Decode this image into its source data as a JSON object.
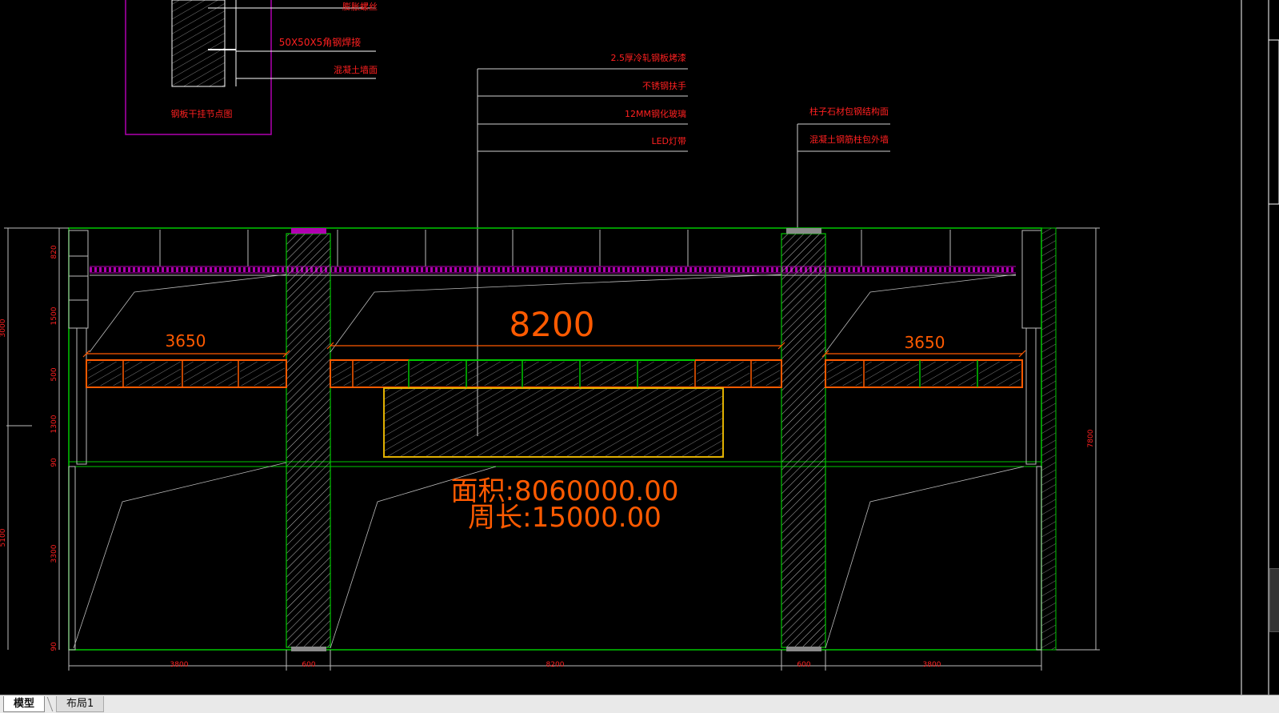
{
  "tabs": [
    {
      "label": "模型",
      "active": true
    },
    {
      "label": "布局1",
      "active": false
    }
  ],
  "detail_box": {
    "title": "钢板干挂节点图",
    "labels": [
      "膨胀螺丝",
      "50X50X5角钢焊接",
      "混凝土墙面"
    ]
  },
  "leaders_center": [
    "2.5厚冷轧钢板烤漆",
    "不锈钢扶手",
    "12MM钢化玻璃",
    "LED灯带"
  ],
  "leaders_right": [
    "柱子石材包钢结构面",
    "混凝土钢筋柱包外墙"
  ],
  "dims": {
    "span_main": "8200",
    "span_left": "3650",
    "span_right": "3650",
    "bottom": [
      "3800",
      "600",
      "8200",
      "600",
      "3800"
    ],
    "left_vertical": [
      "820",
      "1500",
      "500",
      "1300",
      "90",
      "3300",
      "90"
    ],
    "left_outer": [
      "3000",
      "5100"
    ],
    "right_vertical": "7800"
  },
  "annotations": {
    "area": "面积:8060000.00",
    "perimeter": "周长:15000.00"
  },
  "colors": {
    "background": "#000000",
    "structure": "#00c800",
    "dimension": "#ff5a00",
    "text": "#ff2020",
    "leader": "#d0d0d0",
    "accent": "#b000b0"
  }
}
